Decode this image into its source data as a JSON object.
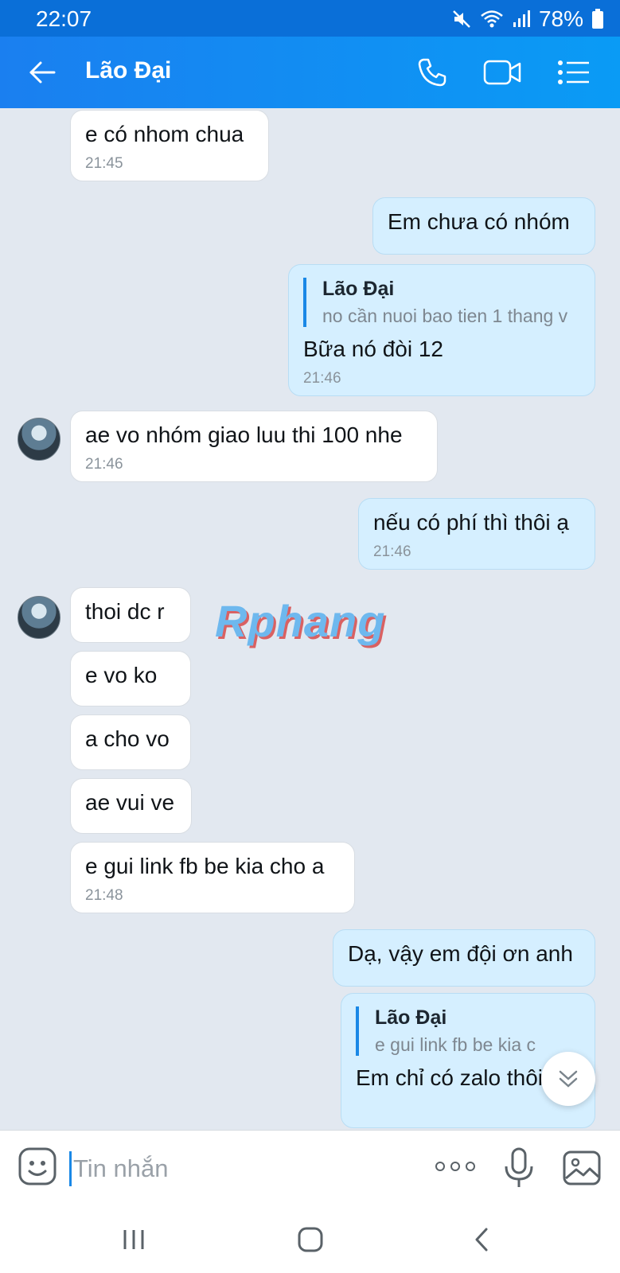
{
  "status_bar": {
    "time": "22:07",
    "battery": "78%",
    "icons": [
      "mute-icon",
      "wifi-icon",
      "signal-icon",
      "battery-icon"
    ]
  },
  "header": {
    "title": "Lão Đại",
    "icons": [
      "back-arrow-icon",
      "phone-icon",
      "video-call-icon",
      "menu-list-icon"
    ],
    "accent_color": "#1a7ff0"
  },
  "messages": [
    {
      "side": "in",
      "text": "e có nhom chua",
      "time": "21:45"
    },
    {
      "side": "out",
      "text": "Em chưa có nhóm"
    },
    {
      "side": "out",
      "quote_name": "Lão Đại",
      "quote_text": "no cần nuoi bao tien 1 thang v",
      "text": "Bữa nó đòi 12",
      "time": "21:46"
    },
    {
      "side": "in",
      "text": "ae vo nhóm giao luu thi 100 nhe",
      "time": "21:46"
    },
    {
      "side": "out",
      "text": "nếu có phí thì thôi ạ",
      "time": "21:46"
    },
    {
      "side": "in",
      "text": "thoi dc r"
    },
    {
      "side": "in",
      "text": "e vo ko"
    },
    {
      "side": "in",
      "text": "a cho vo"
    },
    {
      "side": "in",
      "text": "ae vui ve"
    },
    {
      "side": "in",
      "text": "e gui link fb be kia cho a",
      "time": "21:48"
    },
    {
      "side": "out",
      "text": "Dạ, vậy em đội ơn anh"
    },
    {
      "side": "out",
      "quote_name": "Lão Đại",
      "quote_text": "e gui link fb be kia c",
      "text": "Em chỉ có zalo thôi"
    }
  ],
  "watermark": "Rphang",
  "input": {
    "placeholder": "Tin nhắn",
    "icons": [
      "emoji-icon",
      "more-icon",
      "microphone-icon",
      "image-icon"
    ]
  },
  "nav_bar": {
    "icons": [
      "recent-apps-icon",
      "home-icon",
      "back-icon"
    ]
  },
  "colors": {
    "incoming_bubble": "#ffffff",
    "outgoing_bubble": "#d5efff",
    "chat_background": "#e2e8f0"
  }
}
